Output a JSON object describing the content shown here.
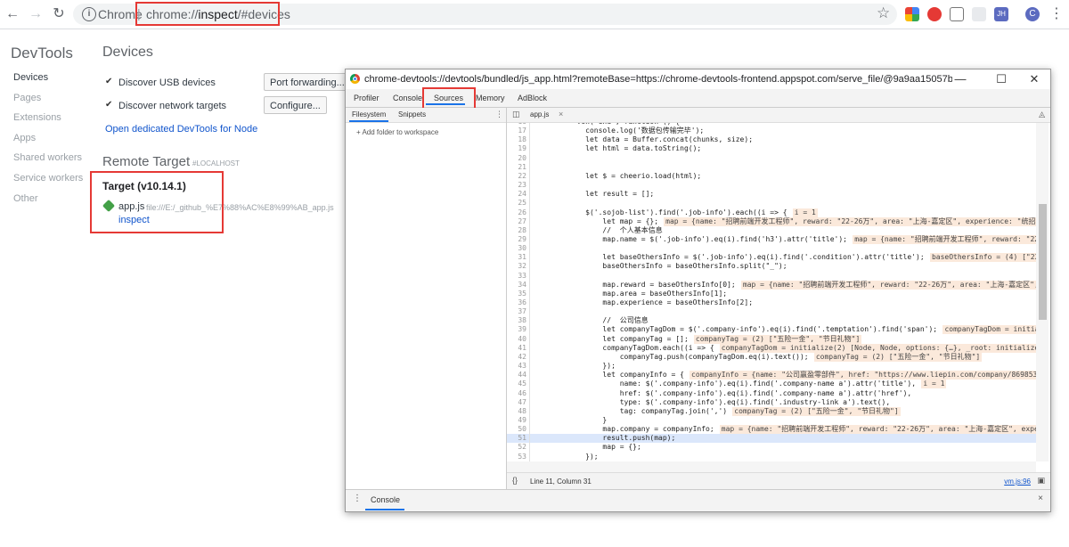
{
  "browser": {
    "origin_label": "Chrome",
    "url": "chrome://inspect/#devices",
    "url_prefix": "chrome://",
    "url_main": "inspect",
    "url_hash": "/#devices",
    "avatar_initial": "C",
    "jh_badge": "JH"
  },
  "inspect": {
    "sidebar_title": "DevTools",
    "sidebar_items": [
      "Devices",
      "Pages",
      "Extensions",
      "Apps",
      "Shared workers",
      "Service workers",
      "Other"
    ],
    "heading": "Devices",
    "discover_usb": "Discover USB devices",
    "discover_network": "Discover network targets",
    "port_forwarding_button": "Port forwarding...",
    "configure_button": "Configure...",
    "node_link": "Open dedicated DevTools for Node",
    "remote_title": "Remote Target",
    "remote_host": "#LOCALHOST",
    "target_title": "Target (v10.14.1)",
    "app_name": "app.js",
    "app_path": "file:///E:/_github_%E7%88%AC%E8%99%AB_app.js",
    "inspect_link": "inspect"
  },
  "devtools": {
    "window_title": "chrome-devtools://devtools/bundled/js_app.html?remoteBase=https://chrome-devtools-frontend.appspot.com/serve_file/@9a9aa15057b6b2cc0...",
    "tabs": [
      "Profiler",
      "Console",
      "Sources",
      "Memory",
      "AdBlock"
    ],
    "active_tab": "Sources",
    "nav_tabs": [
      "Filesystem",
      "Snippets"
    ],
    "add_folder": "+ Add folder to workspace",
    "open_file": "app.js",
    "status_position": "Line 11, Column 31",
    "status_file": "vm.js:96",
    "drawer_tab": "Console",
    "code_lines": [
      {
        "n": "16",
        "code": "        .on('end', function () {",
        "inline": ""
      },
      {
        "n": "17",
        "code": "          console.log('数据包传输完毕');",
        "inline": ""
      },
      {
        "n": "18",
        "code": "          let data = Buffer.concat(chunks, size);",
        "inline": ""
      },
      {
        "n": "19",
        "code": "          let html = data.toString();",
        "inline": ""
      },
      {
        "n": "20",
        "code": "",
        "inline": ""
      },
      {
        "n": "21",
        "code": "",
        "inline": ""
      },
      {
        "n": "22",
        "code": "          let $ = cheerio.load(html);",
        "inline": ""
      },
      {
        "n": "23",
        "code": "",
        "inline": ""
      },
      {
        "n": "24",
        "code": "          let result = [];",
        "inline": ""
      },
      {
        "n": "25",
        "code": "",
        "inline": ""
      },
      {
        "n": "26",
        "code": "          $('.sojob-list').find('.job-info').each((i => {",
        "inline": "i = 1"
      },
      {
        "n": "27",
        "code": "              let map = {};",
        "inline": "map = {name: \"招聘前端开发工程师\", reward: \"22-26万\", area: \"上海-嘉定区\", experience: \"统招本科"
      },
      {
        "n": "28",
        "code": "              //  个人基本信息",
        "inline": ""
      },
      {
        "n": "29",
        "code": "              map.name = $('.job-info').eq(i).find('h3').attr('title');",
        "inline": "map = {name: \"招聘前端开发工程师\", reward: \"22-26万"
      },
      {
        "n": "30",
        "code": "",
        "inline": ""
      },
      {
        "n": "31",
        "code": "              let baseOthersInfo = $('.job-info').eq(i).find('.condition').attr('title');",
        "inline": "baseOthersInfo = (4) [\"22-26万"
      },
      {
        "n": "32",
        "code": "              baseOthersInfo = baseOthersInfo.split(\"_\");",
        "inline": ""
      },
      {
        "n": "33",
        "code": "",
        "inline": ""
      },
      {
        "n": "34",
        "code": "              map.reward = baseOthersInfo[0];",
        "inline": "map = {name: \"招聘前端开发工程师\", reward: \"22-26万\", area: \"上海-嘉定区\", ex"
      },
      {
        "n": "35",
        "code": "              map.area = baseOthersInfo[1];",
        "inline": ""
      },
      {
        "n": "36",
        "code": "              map.experience = baseOthersInfo[2];",
        "inline": ""
      },
      {
        "n": "37",
        "code": "",
        "inline": ""
      },
      {
        "n": "38",
        "code": "              //  公司信息",
        "inline": ""
      },
      {
        "n": "39",
        "code": "              let companyTagDom = $('.company-info').eq(i).find('.temptation').find('span');",
        "inline": "companyTagDom = initialize("
      },
      {
        "n": "40",
        "code": "              let companyTag = [];",
        "inline": "companyTag = (2) [\"五险一金\", \"节日礼物\"]"
      },
      {
        "n": "41",
        "code": "              companyTagDom.each((i => {",
        "inline": "companyTagDom = initialize(2) [Node, Node, options: {…}, _root: initialize(1), p"
      },
      {
        "n": "42",
        "code": "                  companyTag.push(companyTagDom.eq(i).text());",
        "inline": "companyTag = (2) [\"五险一金\", \"节日礼物\"]"
      },
      {
        "n": "43",
        "code": "              });",
        "inline": ""
      },
      {
        "n": "44",
        "code": "              let companyInfo = {",
        "inline": "companyInfo = {name: \"公司赢盈零部件\", href: \"https://www.liepin.com/company/8698537/?s"
      },
      {
        "n": "45",
        "code": "                  name: $('.company-info').eq(i).find('.company-name a').attr('title'),",
        "inline": "i = 1"
      },
      {
        "n": "46",
        "code": "                  href: $('.company-info').eq(i).find('.company-name a').attr('href'),",
        "inline": ""
      },
      {
        "n": "47",
        "code": "                  type: $('.company-info').eq(i).find('.industry-link a').text(),",
        "inline": ""
      },
      {
        "n": "48",
        "code": "                  tag: companyTag.join(',')",
        "inline": "companyTag = (2) [\"五险一金\", \"节日礼物\"]"
      },
      {
        "n": "49",
        "code": "              }",
        "inline": ""
      },
      {
        "n": "50",
        "code": "              map.company = companyInfo;",
        "inline": "map = {name: \"招聘前端开发工程师\", reward: \"22-26万\", area: \"上海-嘉定区\", experie"
      },
      {
        "n": "51",
        "code": "              result.push(map);",
        "inline": ""
      },
      {
        "n": "52",
        "code": "              map = {};",
        "inline": ""
      },
      {
        "n": "53",
        "code": "          });",
        "inline": ""
      },
      {
        "n": "54",
        "code": "",
        "inline": ""
      }
    ]
  },
  "colors": {
    "annotation_red": "#e53935",
    "link_blue": "#1155cc",
    "tab_underline": "#1a73e8",
    "inline_value_bg": "#fbe9db"
  }
}
